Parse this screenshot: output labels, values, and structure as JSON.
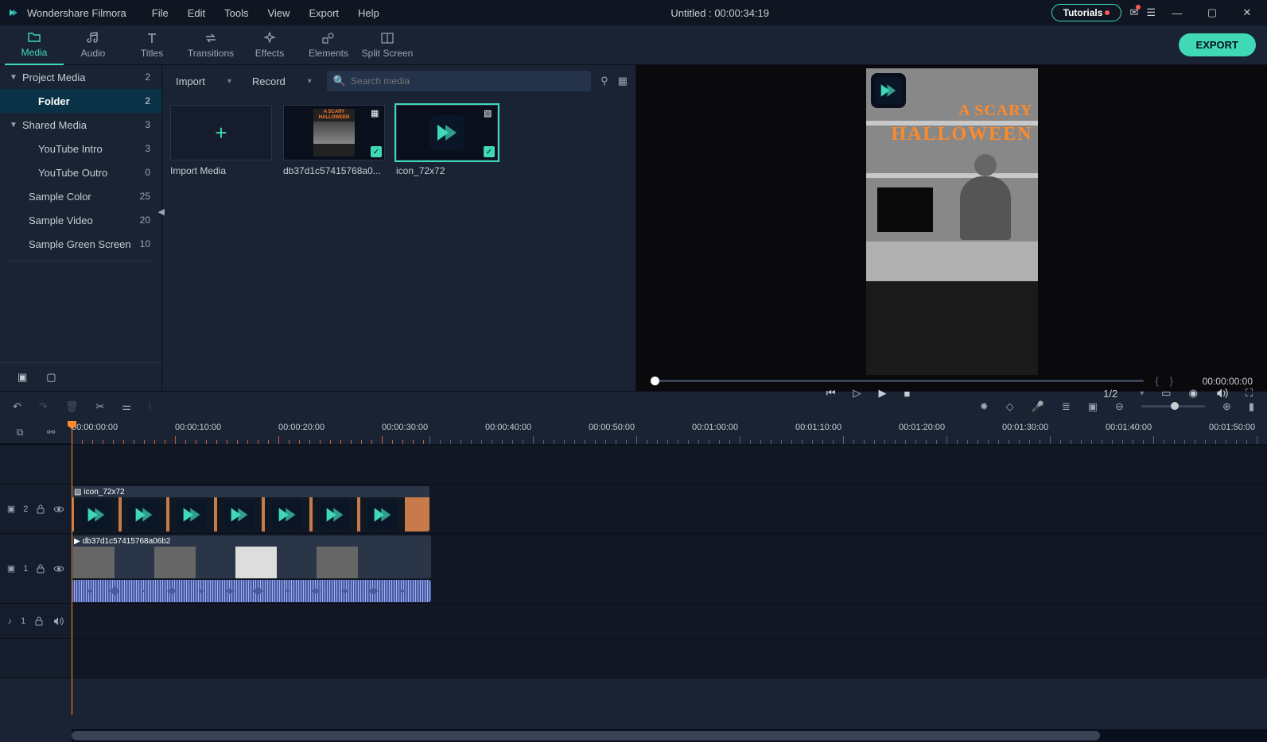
{
  "app_title": "Wondershare Filmora",
  "menu": [
    "File",
    "Edit",
    "Tools",
    "View",
    "Export",
    "Help"
  ],
  "project_title": "Untitled : 00:00:34:19",
  "tutorials_label": "Tutorials",
  "tabs": [
    {
      "label": "Media",
      "icon": "folder"
    },
    {
      "label": "Audio",
      "icon": "music"
    },
    {
      "label": "Titles",
      "icon": "text"
    },
    {
      "label": "Transitions",
      "icon": "swap"
    },
    {
      "label": "Effects",
      "icon": "sparkle"
    },
    {
      "label": "Elements",
      "icon": "shapes"
    },
    {
      "label": "Split Screen",
      "icon": "split"
    }
  ],
  "export_label": "EXPORT",
  "sidebar": {
    "groups": [
      {
        "label": "Project Media",
        "count": "2",
        "expanded": true,
        "children": [
          {
            "label": "Folder",
            "count": "2",
            "selected": true
          }
        ]
      },
      {
        "label": "Shared Media",
        "count": "3",
        "expanded": true,
        "children": [
          {
            "label": "YouTube Intro",
            "count": "3"
          },
          {
            "label": "YouTube Outro",
            "count": "0"
          }
        ]
      }
    ],
    "flat": [
      {
        "label": "Sample Color",
        "count": "25"
      },
      {
        "label": "Sample Video",
        "count": "20"
      },
      {
        "label": "Sample Green Screen",
        "count": "10"
      }
    ]
  },
  "media_toolbar": {
    "import_label": "Import",
    "record_label": "Record",
    "search_placeholder": "Search media"
  },
  "media_items": {
    "import_label": "Import Media",
    "clip1_label": "db37d1c57415768a0...",
    "clip2_label": "icon_72x72"
  },
  "preview": {
    "text1": "A SCARY",
    "text2": "HALLOWEEN",
    "scrub_time": "00:00:00:00",
    "ratio": "1/2"
  },
  "ruler_labels": [
    "00:00:00:00",
    "00:00:10:00",
    "00:00:20:00",
    "00:00:30:00",
    "00:00:40:00",
    "00:00:50:00",
    "00:01:00:00",
    "00:01:10:00",
    "00:01:20:00",
    "00:01:30:00",
    "00:01:40:00",
    "00:01:50:00"
  ],
  "tracks": {
    "t2_label": "2",
    "t1_label": "1",
    "a1_label": "1",
    "clip_pip": "icon_72x72",
    "clip_vid": "db37d1c57415768a06b2"
  }
}
